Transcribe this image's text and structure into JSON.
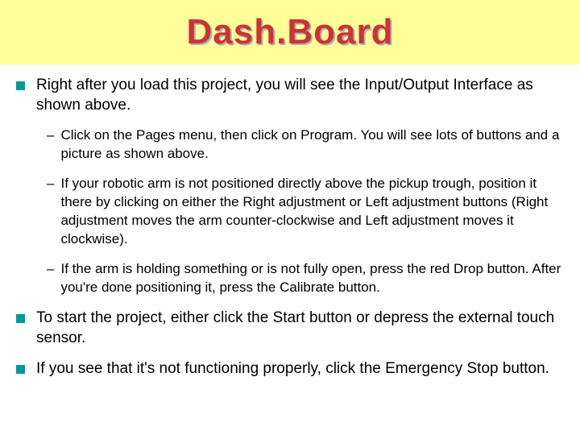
{
  "title": "Dash.Board",
  "bullets": {
    "b1": "Right after you load this project, you will see the Input/Output Interface as shown above.",
    "b2": "To start the project, either click the Start button or depress the external touch sensor.",
    "b3": "If you see that it's not functioning properly, click the Emergency Stop button."
  },
  "subs": {
    "s1": "Click on the Pages menu, then click on Program. You will see lots of buttons and a picture as shown above.",
    "s2": "If your robotic arm is not positioned directly above the pickup trough, position it there by clicking on either the Right adjustment or Left adjustment buttons (Right adjustment moves the arm counter-clockwise and Left adjustment moves it clockwise).",
    "s3": "If the arm is holding something or is not fully open, press the red Drop button. After you're done positioning it, press the Calibrate button."
  },
  "dash": "–"
}
